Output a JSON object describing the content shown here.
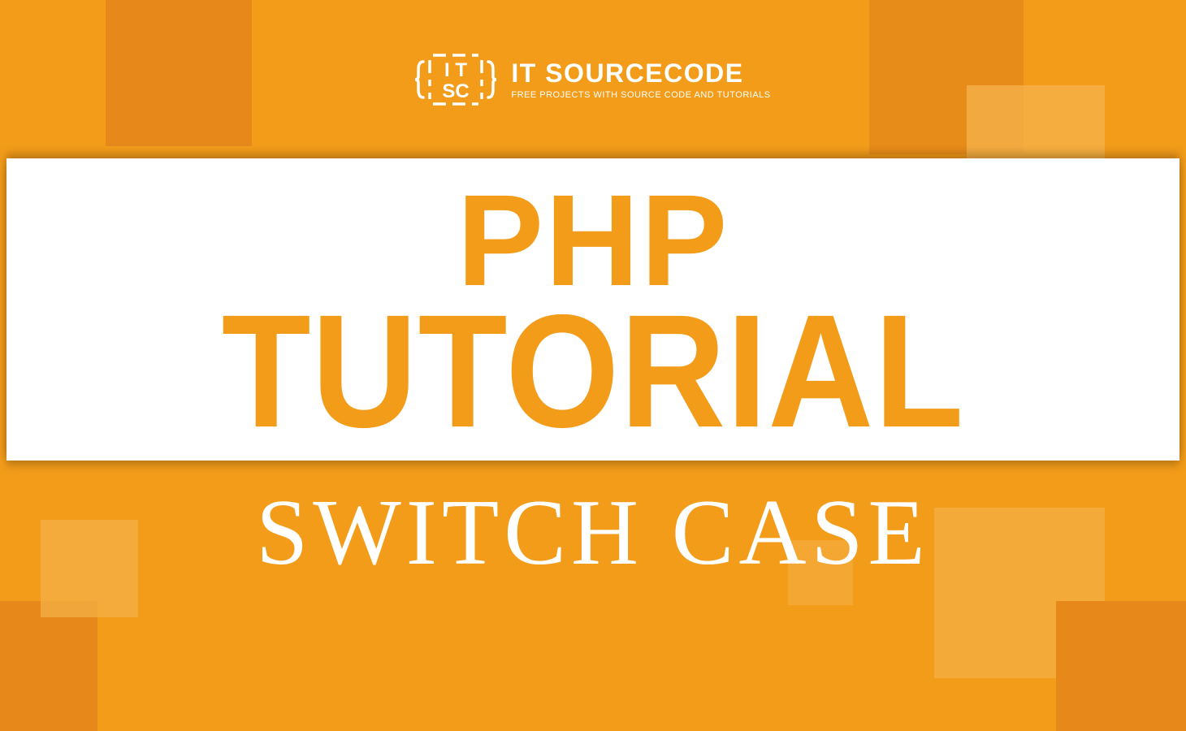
{
  "brand": {
    "name": "IT SOURCECODE",
    "tagline": "FREE PROJECTS WITH SOURCE CODE AND TUTORIALS",
    "logo_text_top": "IT",
    "logo_text_bottom": "SC"
  },
  "main_title": {
    "line1": "PHP",
    "line2": "TUTORIAL"
  },
  "subtitle": "SWITCH CASE",
  "colors": {
    "primary_orange": "#f39c1a",
    "dark_orange": "#e6891a",
    "light_orange": "#f5b24a",
    "white": "#ffffff"
  }
}
